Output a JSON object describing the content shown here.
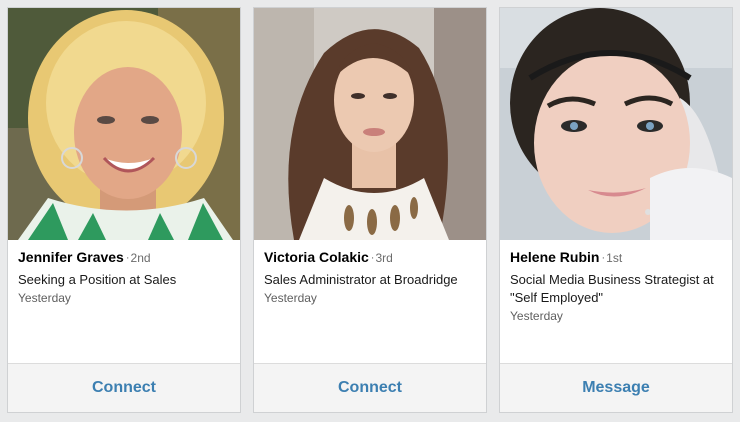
{
  "cards": [
    {
      "name": "Jennifer Graves",
      "degree": "2nd",
      "headline": "Seeking a Position at Sales",
      "time": "Yesterday",
      "action": "Connect",
      "photo_icon": "profile-photo"
    },
    {
      "name": "Victoria Colakic",
      "degree": "3rd",
      "headline": "Sales Administrator at Broadridge",
      "time": "Yesterday",
      "action": "Connect",
      "photo_icon": "profile-photo"
    },
    {
      "name": "Helene Rubin",
      "degree": "1st",
      "headline": "Social Media Business Strategist at \"Self Employed\"",
      "time": "Yesterday",
      "action": "Message",
      "photo_icon": "profile-photo"
    }
  ],
  "separator": "·",
  "colors": {
    "action_text": "#3c7fb1",
    "page_background": "#e9eaeb",
    "card_background": "#ffffff"
  }
}
